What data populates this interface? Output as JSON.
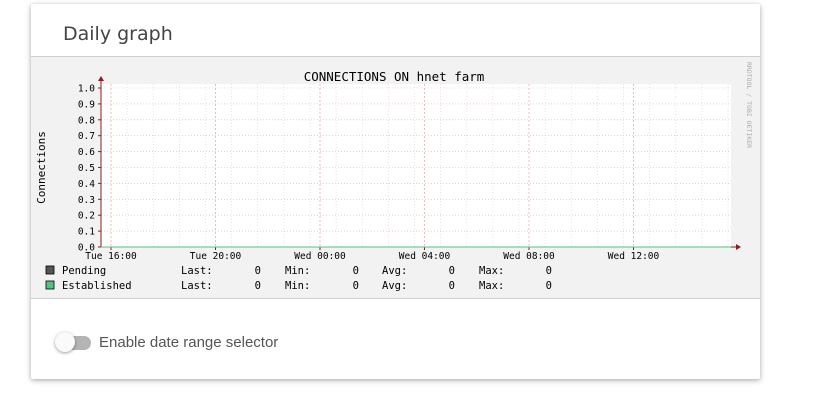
{
  "panel": {
    "title": "Daily graph"
  },
  "graph": {
    "title": "CONNECTIONS ON hnet farm",
    "side_text": "RRDTOOL / TOBI OETIKER",
    "colors": {
      "background": "#f2f2f2",
      "grid": "#e7a1a1",
      "axis": "#8a1e1e",
      "text": "#000000",
      "pending": "#555555",
      "established": "#52c481"
    }
  },
  "chart_data": {
    "type": "line",
    "title": "CONNECTIONS ON hnet farm",
    "ylabel": "Connections",
    "xlabel": "",
    "ylim": [
      0,
      1.0
    ],
    "y_ticks": [
      "1.0",
      "0.9",
      "0.8",
      "0.7",
      "0.6",
      "0.5",
      "0.4",
      "0.3",
      "0.2",
      "0.1",
      "0.0"
    ],
    "x_ticks": [
      "Tue 16:00",
      "Tue 20:00",
      "Wed 00:00",
      "Wed 04:00",
      "Wed 08:00",
      "Wed 12:00"
    ],
    "grid": true,
    "legend_position": "bottom-left",
    "series": [
      {
        "name": "Pending",
        "color": "#555555",
        "stats": {
          "last": "0",
          "min": "0",
          "avg": "0",
          "max": "0"
        }
      },
      {
        "name": "Established",
        "color": "#52c481",
        "stats": {
          "last": "0",
          "min": "0",
          "avg": "0",
          "max": "0"
        }
      }
    ],
    "stat_labels": {
      "last": "Last:",
      "min": "Min:",
      "avg": "Avg:",
      "max": "Max:"
    }
  },
  "controls": {
    "date_range_toggle": {
      "label": "Enable date range selector",
      "enabled": false
    }
  }
}
